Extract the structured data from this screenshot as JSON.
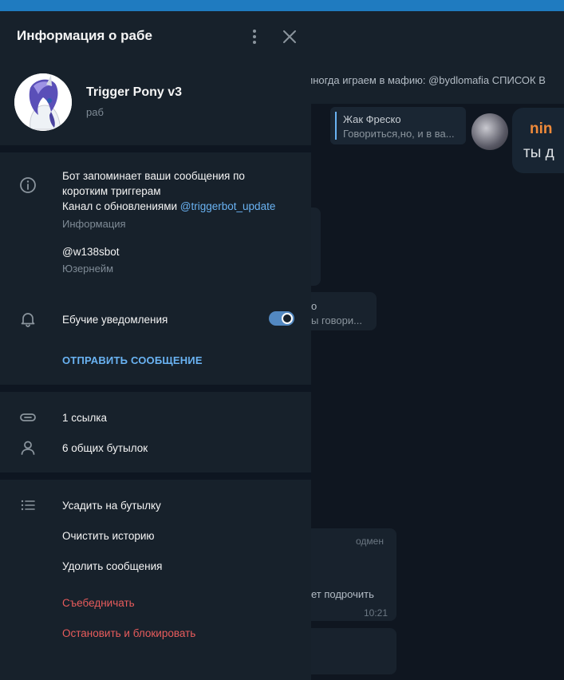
{
  "background": {
    "pinned_text": "ы иногда играем в мафию: @bydlomafia  СПИСОК В",
    "reply_name": "Жак Фреско",
    "reply_text": "Говориться,но, и в ва...",
    "bubble_name": "nin",
    "bubble_text": "ты д",
    "bubble_b_line1": "о",
    "bubble_b_line2": "ы говори...",
    "bubble_c_edited": "одмен",
    "bubble_c_text": "ет подрочить",
    "bubble_c_time": "10:21"
  },
  "panel": {
    "title": "Информация о рабе",
    "profile": {
      "name": "Trigger Pony v3",
      "status": "раб"
    },
    "bio": {
      "line1": "Бот запоминает ваши сообщения по",
      "line2": "коротким триггерам",
      "line3_prefix": "Канал с обновлениями ",
      "line3_link": "@triggerbot_update",
      "label": "Информация"
    },
    "username": {
      "value": "@w138sbot",
      "label": "Юзернейм"
    },
    "notifications": {
      "label": "Ебучие уведомления",
      "enabled": true
    },
    "send_message": "ОТПРАВИТЬ СООБЩЕНИЕ",
    "links": "1 ссылка",
    "groups": "6 общих бутылок",
    "actions": {
      "add_to_group": "Усадить на бутылку",
      "clear_history": "Очистить историю",
      "delete_messages": "Удолить сообщения",
      "unsubscribe": "Съебедничать",
      "stop_block": "Остановить и блокировать"
    }
  },
  "icons": [
    "more-vertical-icon",
    "close-icon",
    "info-icon",
    "bell-icon",
    "link-icon",
    "user-icon",
    "list-icon"
  ],
  "colors": {
    "panel_bg": "#17212b",
    "accent": "#6ab3f3",
    "toggle_on": "#5288c1",
    "danger": "#e85c5c"
  }
}
